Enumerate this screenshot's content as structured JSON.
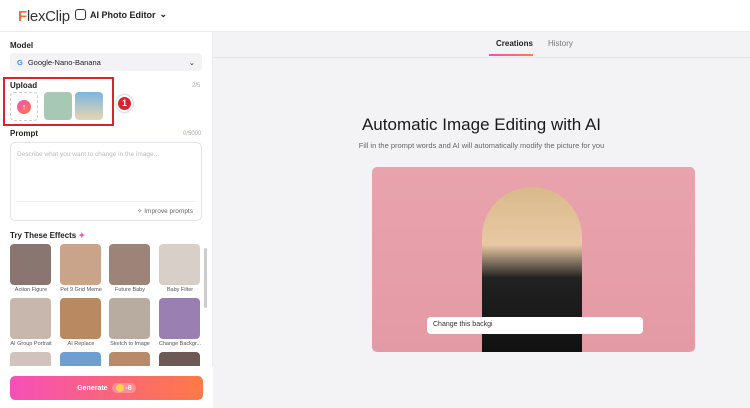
{
  "header": {
    "logo_prefix": "F",
    "logo_rest": "lexClip",
    "tool": "AI Photo Editor"
  },
  "sidebar": {
    "model_label": "Model",
    "model_value": "Google-Nano-Banana",
    "upload_label": "Upload",
    "upload_count": "2/5",
    "annotation_number": "1",
    "prompt_label": "Prompt",
    "prompt_count": "0/5000",
    "prompt_placeholder": "Describe what you want to change in the image...",
    "improve_label": "Improve prompts",
    "effects_label": "Try These Effects",
    "effects": [
      {
        "label": "Action Figure",
        "color": "#8a7670"
      },
      {
        "label": "Pet 9 Grid Meme",
        "color": "#c9a48a"
      },
      {
        "label": "Future Baby",
        "color": "#9c8478"
      },
      {
        "label": "Baby Filter",
        "color": "#d8cfc8"
      },
      {
        "label": "AI Group Portrait",
        "color": "#c7b7ad"
      },
      {
        "label": "AI Replace",
        "color": "#b98a62"
      },
      {
        "label": "Sketch to Image",
        "color": "#b8aca0"
      },
      {
        "label": "Change Backgr...",
        "color": "#9a7fb3"
      },
      {
        "label": "",
        "color": "#d1c2bb"
      },
      {
        "label": "",
        "color": "#6f9fd1"
      },
      {
        "label": "",
        "color": "#b88a6a"
      },
      {
        "label": "",
        "color": "#6d5a55"
      }
    ],
    "generate_label": "Generate",
    "credits": "-8"
  },
  "main": {
    "tabs": [
      {
        "label": "Creations",
        "active": true
      },
      {
        "label": "History",
        "active": false
      }
    ],
    "title": "Automatic Image Editing with AI",
    "subtitle": "Fill in the prompt words and AI will automatically modify the picture for you",
    "preview_input": "Change this backgi"
  }
}
